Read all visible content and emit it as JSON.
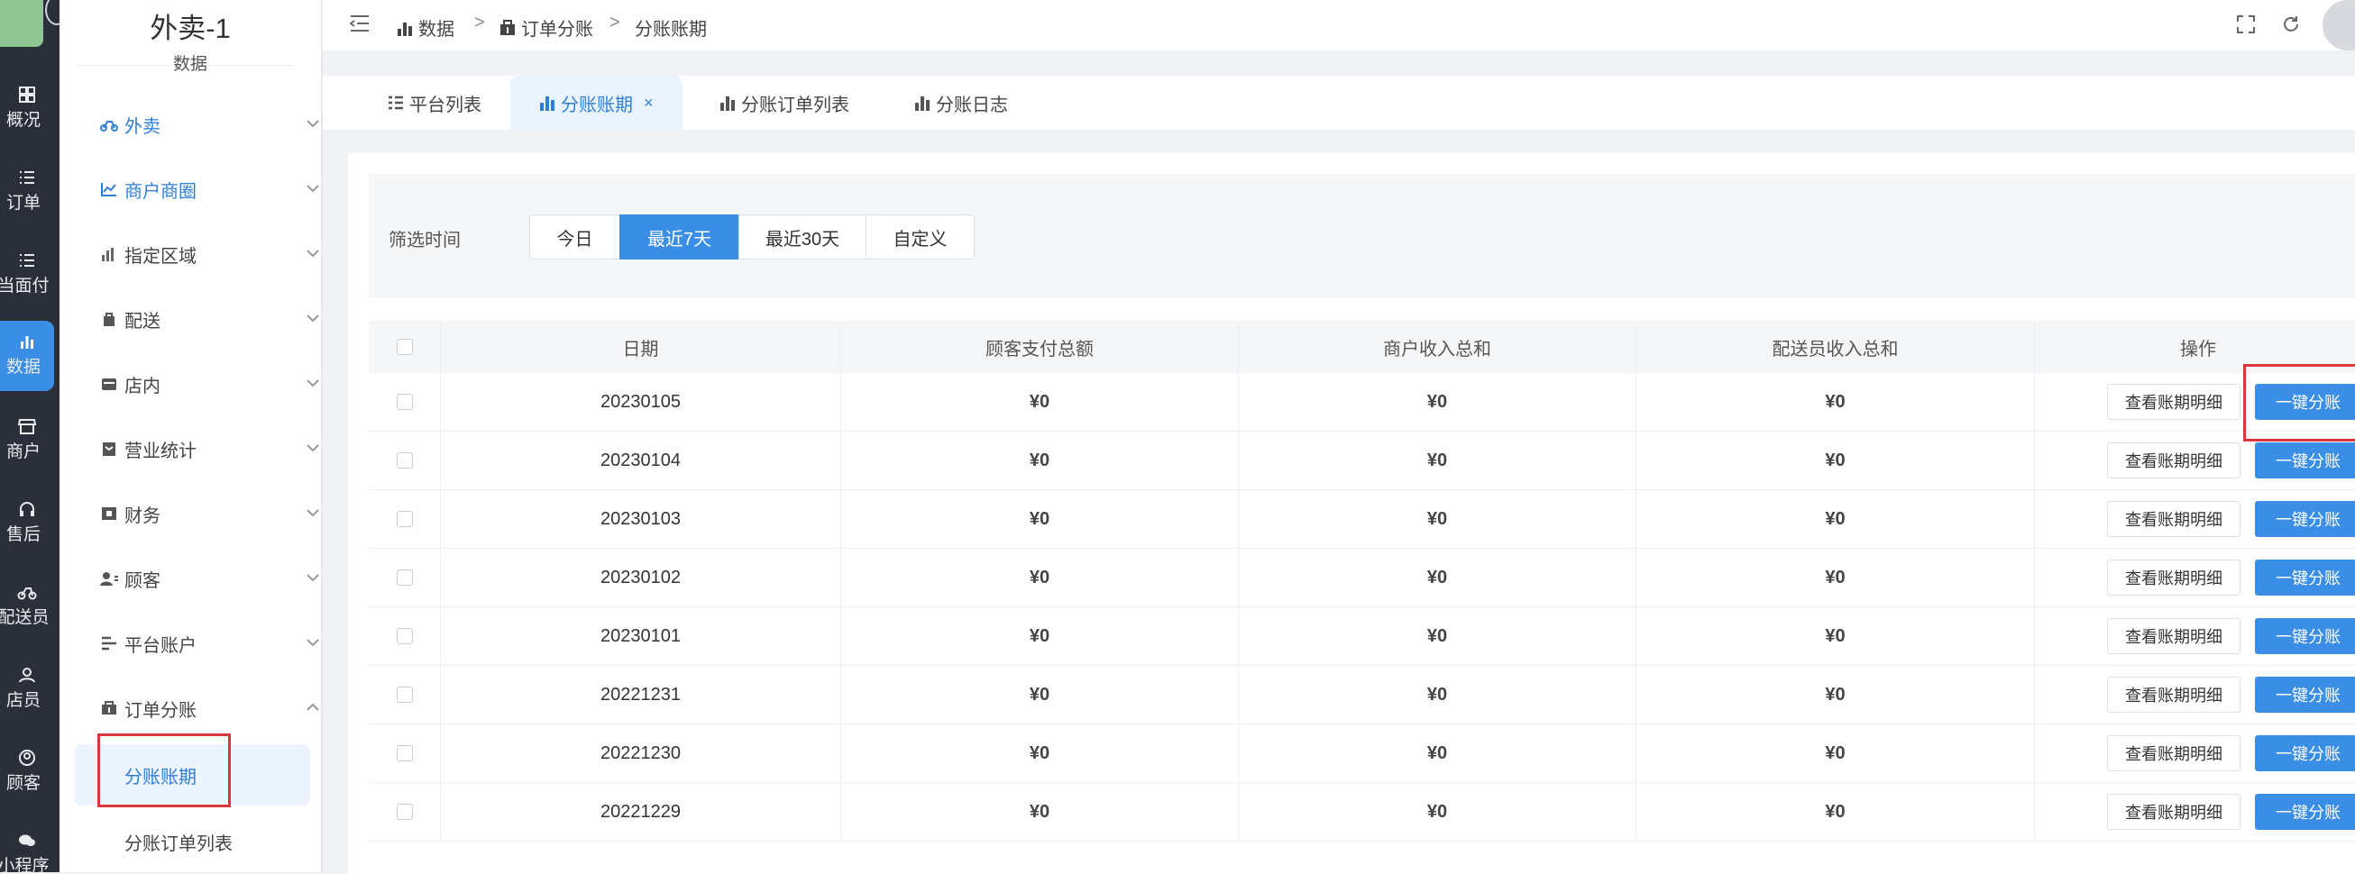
{
  "rail": {
    "items": [
      {
        "label": "概况",
        "icon": "dashboard-icon"
      },
      {
        "label": "订单",
        "icon": "list-icon"
      },
      {
        "label": "当面付",
        "icon": "list-icon"
      },
      {
        "label": "数据",
        "icon": "bar-chart-icon",
        "active": true
      },
      {
        "label": "商户",
        "icon": "store-icon"
      },
      {
        "label": "售后",
        "icon": "headset-icon"
      },
      {
        "label": "配送员",
        "icon": "delivery-icon"
      },
      {
        "label": "店员",
        "icon": "staff-icon"
      },
      {
        "label": "顾客",
        "icon": "customer-icon"
      },
      {
        "label": "小程序",
        "icon": "chat-icon"
      }
    ]
  },
  "sidebar": {
    "brand": "外卖-1",
    "section": "数据",
    "menu": [
      {
        "label": "外卖",
        "icon": "delivery-icon",
        "highlight": true
      },
      {
        "label": "商户商圈",
        "icon": "line-chart-icon",
        "highlight": true
      },
      {
        "label": "指定区域",
        "icon": "bar-chart-icon"
      },
      {
        "label": "配送",
        "icon": "bag-icon"
      },
      {
        "label": "店内",
        "icon": "shop-icon"
      },
      {
        "label": "营业统计",
        "icon": "box-icon"
      },
      {
        "label": "财务",
        "icon": "wallet-icon"
      },
      {
        "label": "顾客",
        "icon": "user-icon"
      },
      {
        "label": "平台账户",
        "icon": "align-icon"
      },
      {
        "label": "订单分账",
        "icon": "split-icon",
        "expanded": true
      }
    ],
    "submenu": [
      {
        "label": "分账账期",
        "active": true
      },
      {
        "label": "分账订单列表"
      }
    ]
  },
  "header": {
    "breadcrumb": [
      {
        "label": "数据",
        "icon": "bar-chart-icon"
      },
      {
        "label": "订单分账",
        "icon": "split-icon"
      },
      {
        "label": "分账账期"
      }
    ],
    "separator": ">"
  },
  "tabs": [
    {
      "label": "平台列表",
      "icon": "list-icon"
    },
    {
      "label": "分账账期",
      "icon": "bar-chart-icon",
      "active": true,
      "close": "×"
    },
    {
      "label": "分账订单列表",
      "icon": "bar-chart-icon"
    },
    {
      "label": "分账日志",
      "icon": "bar-chart-icon"
    }
  ],
  "filter": {
    "label": "筛选时间",
    "options": [
      "今日",
      "最近7天",
      "最近30天",
      "自定义"
    ],
    "selected": "最近7天"
  },
  "table": {
    "columns": [
      "日期",
      "顾客支付总额",
      "商户收入总和",
      "配送员收入总和",
      "操作"
    ],
    "rows": [
      {
        "date": "20230105",
        "customer": "¥0",
        "merchant": "¥0",
        "rider": "¥0"
      },
      {
        "date": "20230104",
        "customer": "¥0",
        "merchant": "¥0",
        "rider": "¥0"
      },
      {
        "date": "20230103",
        "customer": "¥0",
        "merchant": "¥0",
        "rider": "¥0"
      },
      {
        "date": "20230102",
        "customer": "¥0",
        "merchant": "¥0",
        "rider": "¥0"
      },
      {
        "date": "20230101",
        "customer": "¥0",
        "merchant": "¥0",
        "rider": "¥0"
      },
      {
        "date": "20221231",
        "customer": "¥0",
        "merchant": "¥0",
        "rider": "¥0"
      },
      {
        "date": "20221230",
        "customer": "¥0",
        "merchant": "¥0",
        "rider": "¥0"
      },
      {
        "date": "20221229",
        "customer": "¥0",
        "merchant": "¥0",
        "rider": "¥0"
      }
    ],
    "actions": {
      "detail": "查看账期明细",
      "split": "一键分账"
    }
  },
  "colors": {
    "accent": "#3a8ee6",
    "highlight_box": "#d9383a",
    "rail": "#2b2f3a"
  }
}
